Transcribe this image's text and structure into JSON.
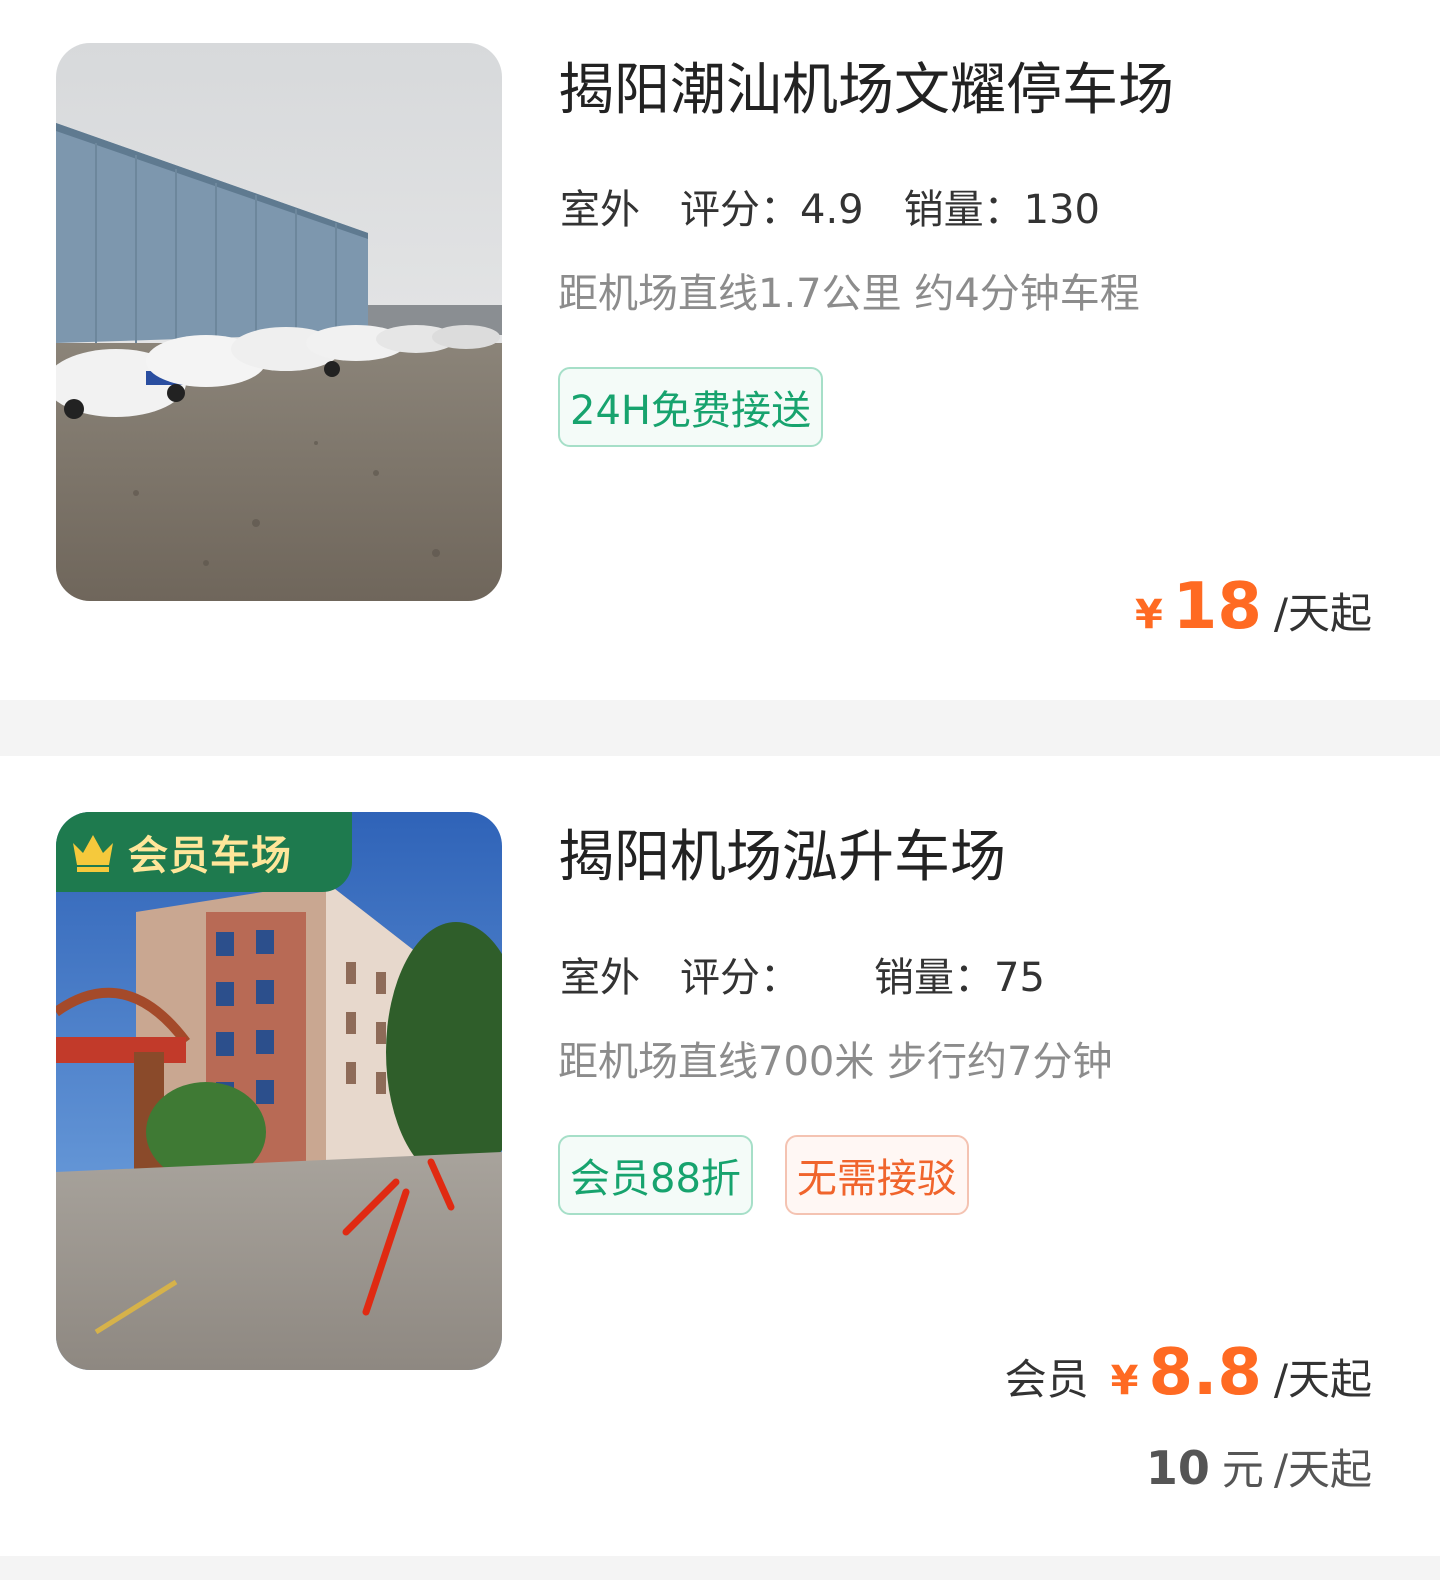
{
  "listings": [
    {
      "title": "揭阳潮汕机场文耀停车场",
      "type": "室外",
      "score_label": "评分：",
      "score": "4.9",
      "sales_label": "销量：",
      "sales": "130",
      "distance": "距机场直线1.7公里 约4分钟车程",
      "tags": [
        "24H免费接送"
      ],
      "price": {
        "currency": "¥",
        "amount": "18",
        "unit": "/天起"
      }
    },
    {
      "badge": "会员车场",
      "title": "揭阳机场泓升车场",
      "type": "室外",
      "score_label": "评分：",
      "score": "",
      "sales_label": "销量：",
      "sales": "75",
      "distance": "距机场直线700米 步行约7分钟",
      "tags": [
        "会员88折",
        "无需接驳"
      ],
      "price": {
        "member_label": "会员",
        "currency": "¥",
        "amount": "8.8",
        "unit": "/天起"
      },
      "original_price": {
        "amount": "10",
        "currency": "元",
        "unit": "/天起"
      }
    }
  ],
  "colors": {
    "price": "#ff6a22",
    "green_tag": "#17a36e",
    "orange_tag": "#f0642c",
    "badge_bg": "#1e7a4e",
    "badge_text": "#ffe69a"
  },
  "icons": {
    "badge_icon": "crown-icon"
  }
}
